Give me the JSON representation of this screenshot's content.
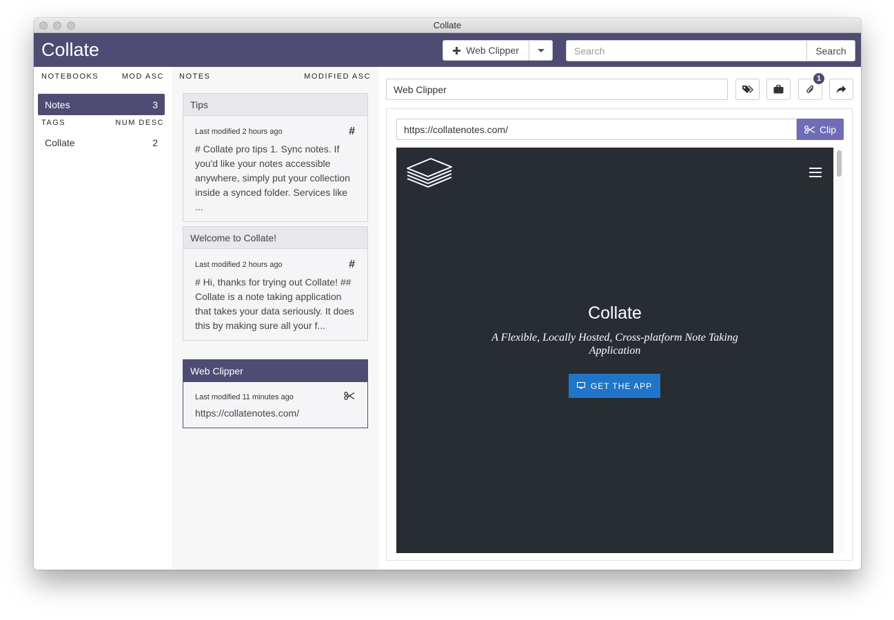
{
  "window": {
    "title": "Collate"
  },
  "appbar": {
    "brand": "Collate",
    "new_note_label": "Web Clipper",
    "search_placeholder": "Search",
    "search_button": "Search"
  },
  "notebooks": {
    "heading": "NOTEBOOKS",
    "sort": "MOD ASC",
    "items": [
      {
        "label": "Notes",
        "count": "3"
      }
    ]
  },
  "tags": {
    "heading": "TAGS",
    "sort": "NUM DESC",
    "items": [
      {
        "label": "Collate",
        "count": "2"
      }
    ]
  },
  "notes": {
    "heading": "NOTES",
    "sort": "MODIFIED ASC",
    "items": [
      {
        "title": "Tips",
        "modified": "Last modified 2 hours ago",
        "icon": "hash-icon",
        "excerpt": "# Collate pro tips 1. Sync notes. If you'd like your notes accessible anywhere, simply put your collection inside a synced folder. Services like ..."
      },
      {
        "title": "Welcome to Collate!",
        "modified": "Last modified 2 hours ago",
        "icon": "hash-icon",
        "excerpt": "# Hi, thanks for trying out Collate! ## Collate is a note taking application that takes your data seriously. It does this by making sure all your f..."
      },
      {
        "title": "Web Clipper",
        "modified": "Last modified 11 minutes ago",
        "icon": "scissors-icon",
        "excerpt": "https://collatenotes.com/"
      }
    ]
  },
  "editor": {
    "title": "Web Clipper",
    "attachments_badge": "1",
    "url": "https://collatenotes.com/",
    "clip_label": "Clip"
  },
  "preview": {
    "site_title": "Collate",
    "site_subtitle": "A Flexible, Locally Hosted, Cross-platform Note Taking Application",
    "cta_label": "GET THE APP"
  },
  "colors": {
    "accent": "#4e4c73",
    "clip": "#6f6db8",
    "cta": "#1f75c7",
    "preview_bg": "#282c33"
  }
}
